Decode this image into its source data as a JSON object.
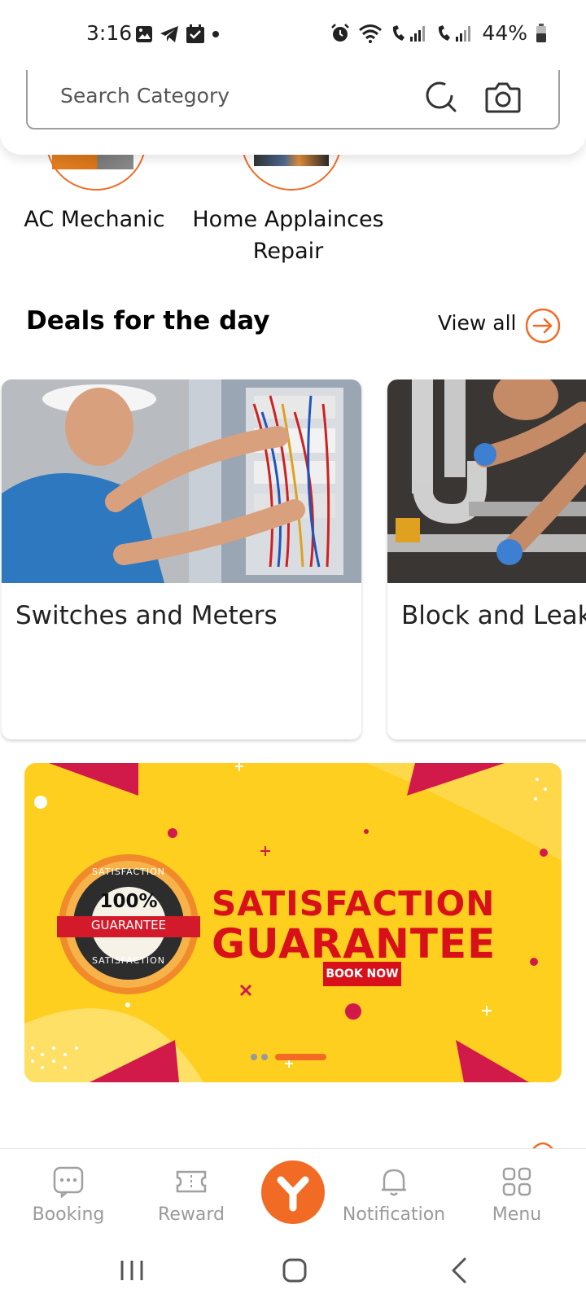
{
  "status_bar": {
    "time": "3:16",
    "battery": "44%"
  },
  "search": {
    "placeholder": "Search Category"
  },
  "categories": [
    {
      "label": "AC Mechanic",
      "icon": "ac-mechanic-photo"
    },
    {
      "label": "Home Appliances Repair",
      "line1": "Home Applaince Repair"
    }
  ],
  "category_labels": {
    "ac": "AC Mechanic",
    "home_line1": "Home Applainces",
    "home_line2": "Repair"
  },
  "deals": {
    "title": "Deals for the day",
    "view_all": "View all",
    "items": [
      {
        "label": "Switches and Meters"
      },
      {
        "label": "Block and Leak"
      }
    ]
  },
  "banner": {
    "line1": "SATISFACTION",
    "line2": "GUARANTEE",
    "book_now": "BOOK NOW",
    "seal_top": "SATISFACTION",
    "seal_percent": "100%",
    "seal_ribbon": "GUARANTEE",
    "seal_bottom": "SATISFACTION",
    "active_slide": 3,
    "slide_count": 3
  },
  "bottom_nav": {
    "items": [
      {
        "label": "Booking",
        "icon": "chat-dots-icon"
      },
      {
        "label": "Reward",
        "icon": "ticket-icon"
      },
      {
        "label": "",
        "icon": "app-logo-icon"
      },
      {
        "label": "Notification",
        "icon": "bell-icon"
      },
      {
        "label": "Menu",
        "icon": "grid-icon"
      }
    ]
  },
  "colors": {
    "accent": "#f26b25",
    "banner_bg": "#ffcf1f",
    "banner_text": "#d8101a",
    "nav_label": "#9a9a9a"
  }
}
